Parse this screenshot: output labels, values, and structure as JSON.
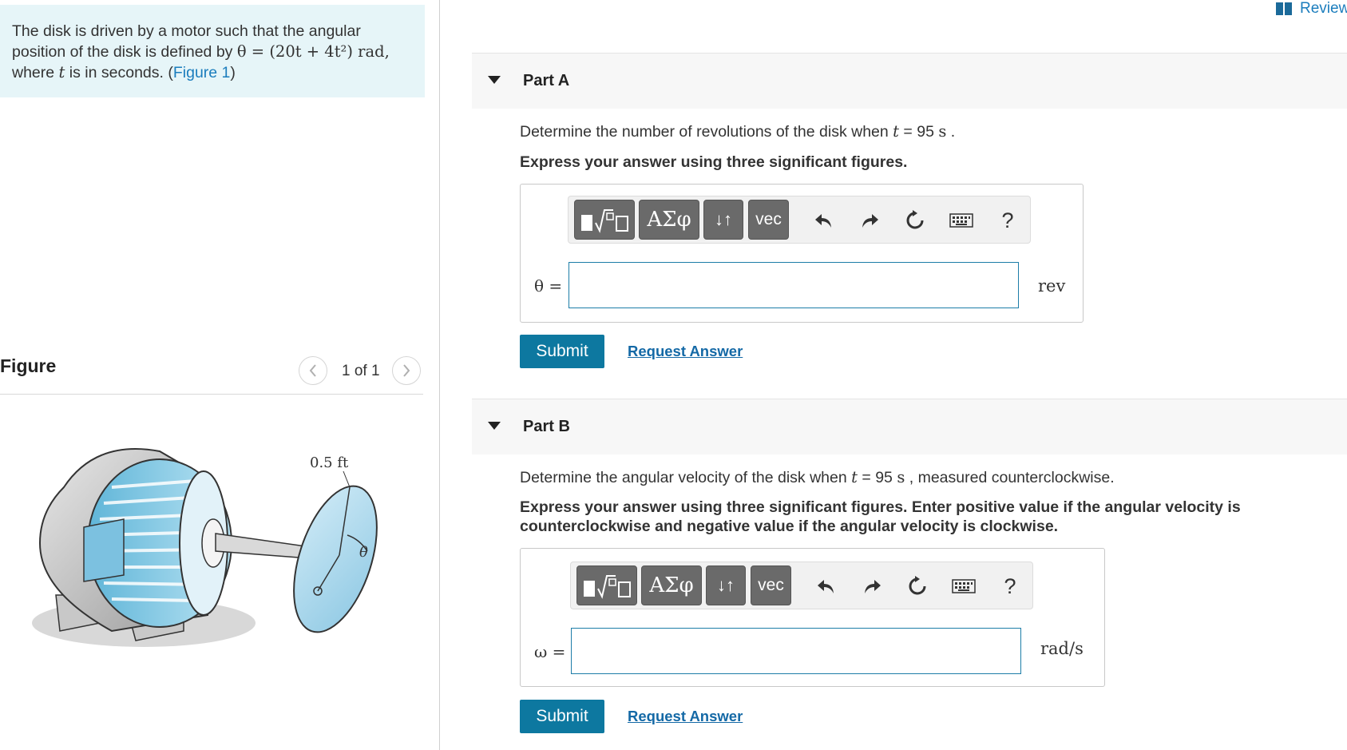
{
  "problem": {
    "text_before": "The disk is driven by a motor such that the angular position of the disk is defined by ",
    "equation": "θ = (20t + 4t²) rad,",
    "text_where": "where ",
    "var_t": "t",
    "text_after": " is in seconds. (",
    "figure_link": "Figure 1",
    "close_paren": ")"
  },
  "figure": {
    "title": "Figure",
    "counter": "1 of 1",
    "prev_icon": "chevron-left-icon",
    "next_icon": "chevron-right-icon",
    "dimension_label": "0.5 ft",
    "angle_label": "θ"
  },
  "review": {
    "label": "Review",
    "icon": "book-icon"
  },
  "toolbar": {
    "greek_label": "ΑΣφ",
    "arrows_label": "↓↑",
    "vec_label": "vec",
    "help_label": "?"
  },
  "parts": [
    {
      "title": "Part A",
      "question_before": "Determine the number of revolutions of the disk when ",
      "question_var": "t",
      "question_eq": " = 95 ",
      "question_unit": "s",
      "question_after": " .",
      "instruction": "Express your answer using three significant figures.",
      "variable": "θ =",
      "input_value": "",
      "unit": "rev",
      "submit_label": "Submit",
      "request_label": "Request Answer"
    },
    {
      "title": "Part B",
      "question_before": "Determine the angular velocity of the disk when ",
      "question_var": "t",
      "question_eq": " = 95 ",
      "question_unit": "s",
      "question_after": " , measured counterclockwise.",
      "instruction": "Express your answer using three significant figures. Enter positive value if the angular velocity is counterclockwise and negative value if the angular velocity is clockwise.",
      "variable": "ω =",
      "input_value": "",
      "unit": "rad/s",
      "submit_label": "Submit",
      "request_label": "Request Answer"
    }
  ]
}
